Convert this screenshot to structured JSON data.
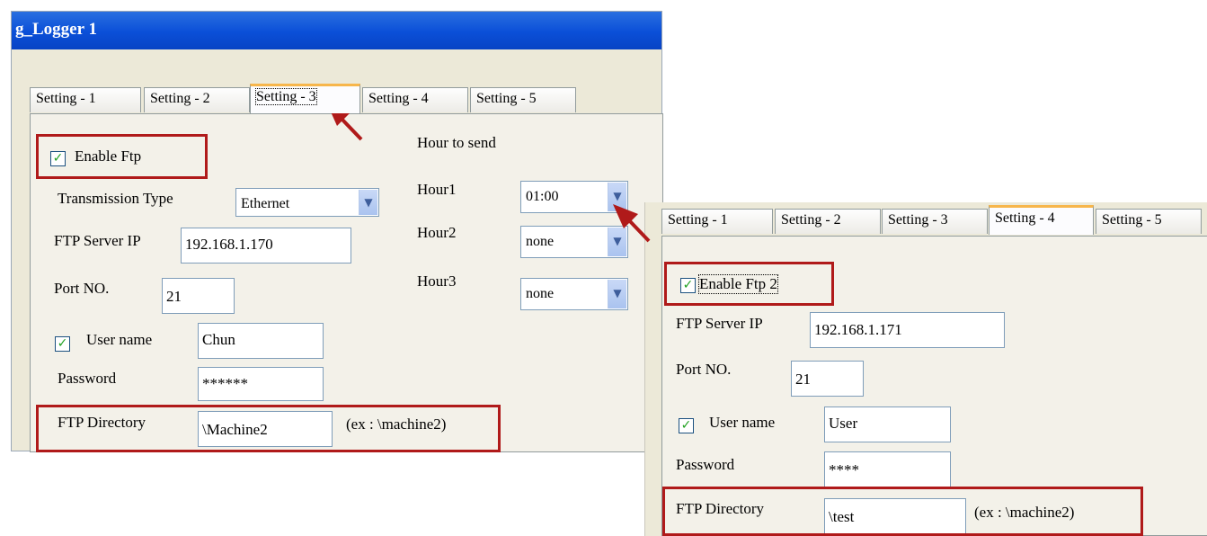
{
  "window1": {
    "title": "g_Logger 1",
    "tabs": [
      "Setting - 1",
      "Setting - 2",
      "Setting - 3",
      "Setting - 4",
      "Setting - 5"
    ],
    "active_tab": "Setting - 3",
    "enable_ftp": {
      "label": "Enable Ftp",
      "checked": true
    },
    "hour_to_send_label": "Hour to send",
    "transmission_type": {
      "label": "Transmission Type",
      "value": "Ethernet"
    },
    "ftp_server_ip": {
      "label": "FTP Server IP",
      "value": "192.168.1.170"
    },
    "port": {
      "label": "Port NO.",
      "value": "21"
    },
    "user_name": {
      "label": "User name",
      "checked": true,
      "value": "Chun"
    },
    "password": {
      "label": "Password",
      "value": "******"
    },
    "ftp_directory": {
      "label": "FTP Directory",
      "value": "\\Machine2",
      "example": "(ex : \\machine2)"
    },
    "hours": [
      {
        "label": "Hour1",
        "value": "01:00"
      },
      {
        "label": "Hour2",
        "value": "none"
      },
      {
        "label": "Hour3",
        "value": "none"
      }
    ]
  },
  "window2": {
    "tabs": [
      "Setting - 1",
      "Setting - 2",
      "Setting - 3",
      "Setting - 4",
      "Setting - 5"
    ],
    "active_tab": "Setting - 4",
    "enable_ftp": {
      "label": "Enable Ftp 2",
      "checked": true
    },
    "ftp_server_ip": {
      "label": "FTP Server IP",
      "value": "192.168.1.171"
    },
    "port": {
      "label": "Port NO.",
      "value": "21"
    },
    "user_name": {
      "label": "User name",
      "checked": true,
      "value": "User"
    },
    "password": {
      "label": "Password",
      "value": "****"
    },
    "ftp_directory": {
      "label": "FTP Directory",
      "value": "\\test",
      "example": "(ex : \\machine2)"
    }
  },
  "icons": {
    "check": "✓",
    "dropdown": "▼"
  },
  "colors": {
    "title_bar": "#0a4fd8",
    "highlight": "#b01a1a",
    "active_tab_accent": "#f7b64b",
    "arrow": "#b01a1a"
  }
}
